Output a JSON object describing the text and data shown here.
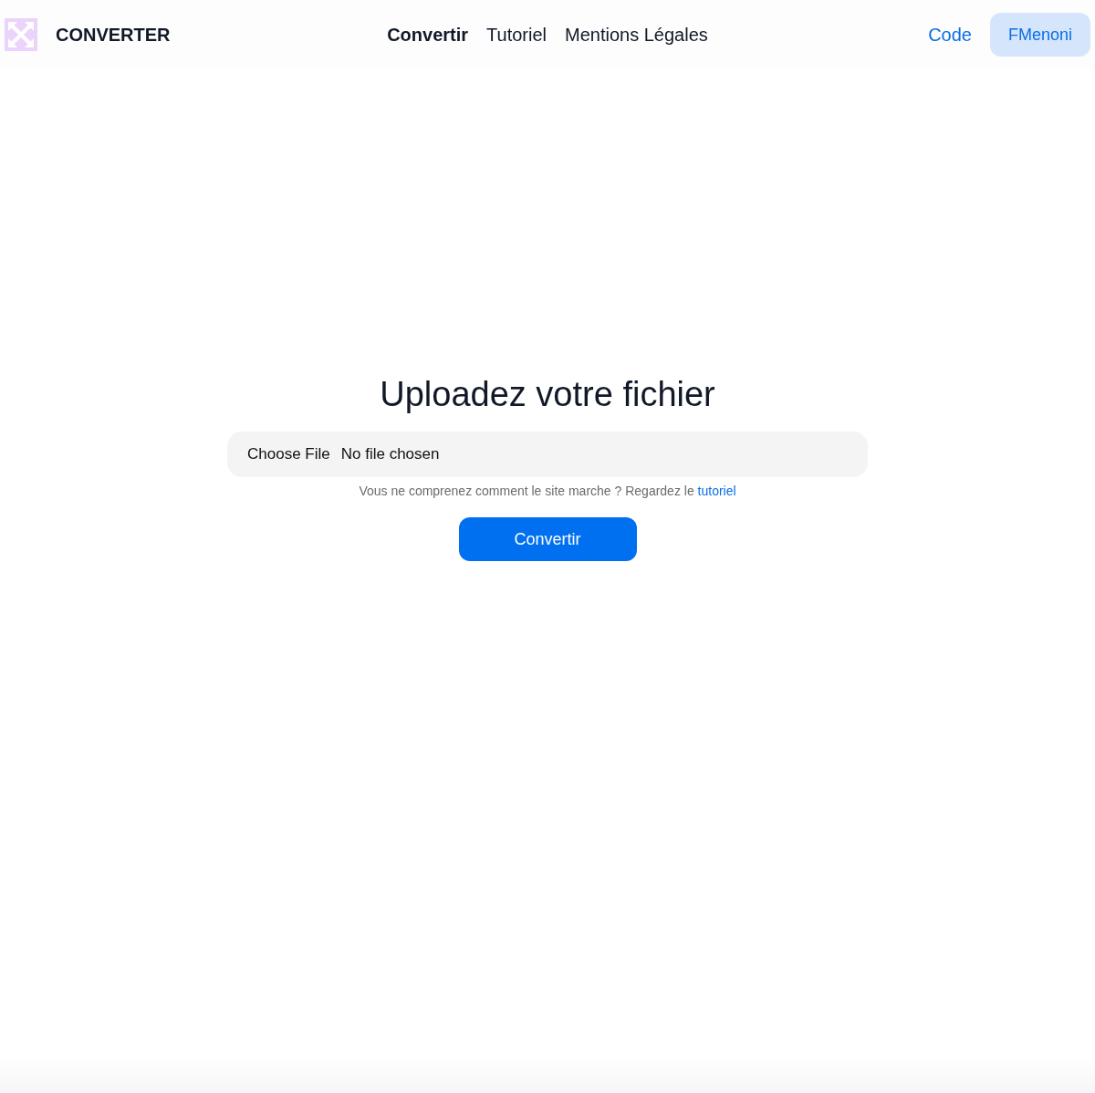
{
  "header": {
    "brand": "CONVERTER",
    "nav": [
      {
        "label": "Convertir",
        "selected": true
      },
      {
        "label": "Tutoriel",
        "selected": false
      },
      {
        "label": "Mentions Légales",
        "selected": false
      }
    ],
    "code_link": "Code",
    "user_button": "FMenoni"
  },
  "main": {
    "title": "Uploadez votre fichier",
    "file_button": "Choose File",
    "file_status": "No file chosen",
    "help_text": "Vous ne comprenez comment le site marche ? Regardez le",
    "help_link": "tutoriel",
    "submit": "Convertir"
  }
}
